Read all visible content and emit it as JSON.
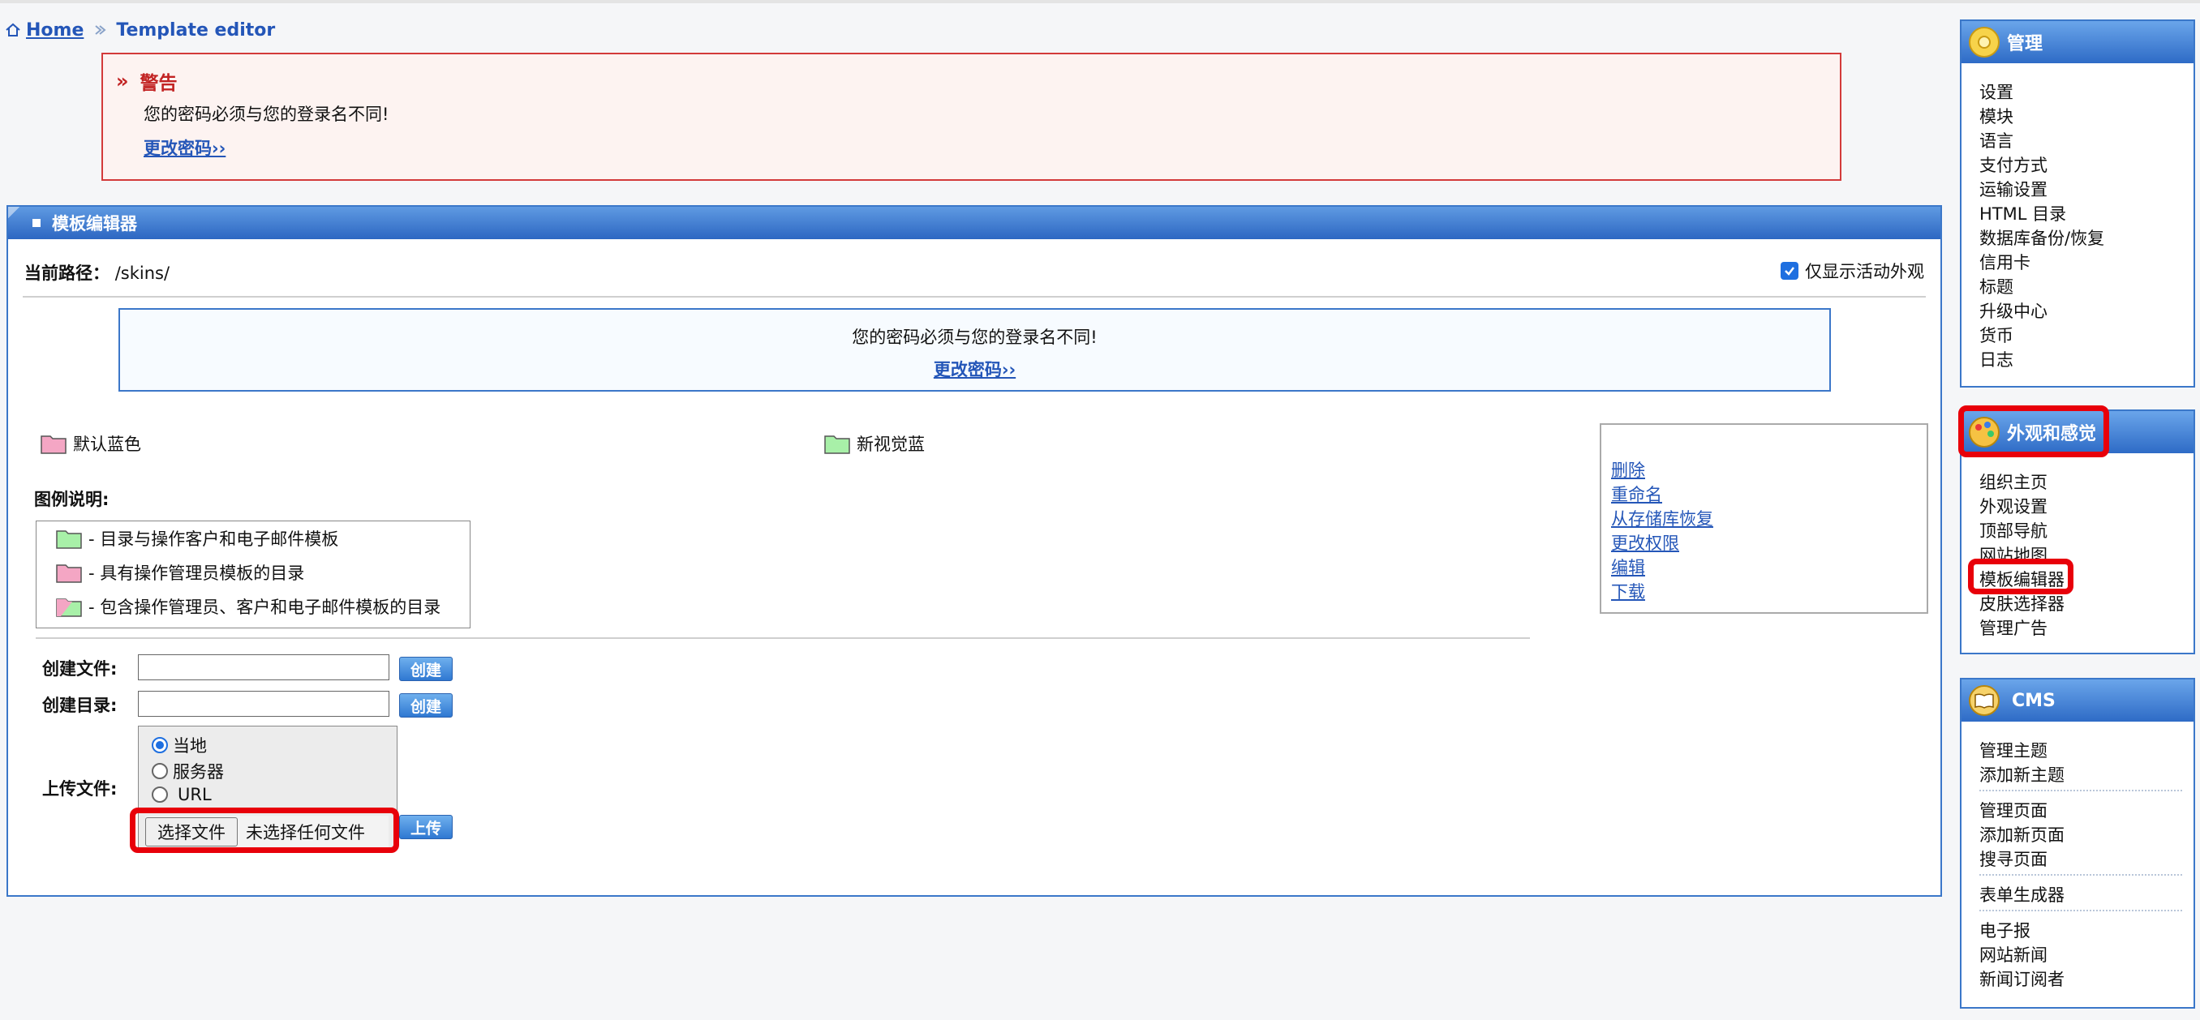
{
  "breadcrumb": {
    "home": "Home",
    "current": "Template editor"
  },
  "warning": {
    "title": "警告",
    "message": "您的密码必须与您的登录名不同!",
    "link": "更改密码››"
  },
  "panel": {
    "title": "模板编辑器",
    "current_path_label": "当前路径：",
    "current_path": "/skins/",
    "only_active_label": "仅显示活动外观",
    "notice_message": "您的密码必须与您的登录名不同!",
    "notice_link": "更改密码››",
    "folders": [
      "默认蓝色",
      "新视觉蓝"
    ],
    "ops": [
      "删除",
      "重命名",
      "从存储库恢复",
      "更改权限",
      "编辑",
      "下载"
    ],
    "legend_title": "图例说明:",
    "legend": [
      "- 目录与操作客户和电子邮件模板",
      "- 具有操作管理员模板的目录",
      "- 包含操作管理员、客户和电子邮件模板的目录"
    ],
    "create_file_label": "创建文件:",
    "create_dir_label": "创建目录:",
    "create_button": "创建",
    "upload_label": "上传文件:",
    "upload_sources": [
      "当地",
      "服务器",
      "URL"
    ],
    "choose_file_button": "选择文件",
    "no_file_text": "未选择任何文件",
    "upload_button": "上传"
  },
  "sidebar": {
    "admin": {
      "title": "管理",
      "items": [
        "设置",
        "模块",
        "语言",
        "支付方式",
        "运输设置",
        "HTML 目录",
        "数据库备份/恢复",
        "信用卡",
        "标题",
        "升级中心",
        "货币",
        "日志"
      ]
    },
    "look": {
      "title": "外观和感觉",
      "items": [
        "组织主页",
        "外观设置",
        "顶部导航",
        "网站地图",
        "模板编辑器",
        "皮肤选择器",
        "管理广告"
      ]
    },
    "cms": {
      "title": "CMS",
      "items": [
        "管理主题",
        "添加新主题",
        "管理页面",
        "添加新页面",
        "搜寻页面",
        "表单生成器",
        "电子报",
        "网站新闻",
        "新闻订阅者"
      ]
    }
  }
}
